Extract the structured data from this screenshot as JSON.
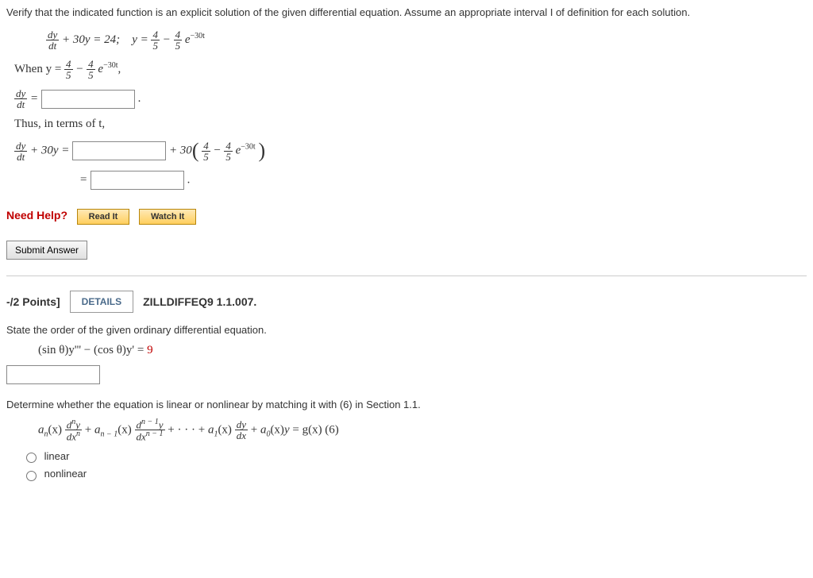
{
  "q1": {
    "instruction": "Verify that the indicated function is an explicit solution of the given differential equation. Assume an appropriate interval I of definition for each solution.",
    "eq_lhs_plus": " + 30y = 24;",
    "eq_y": "y = ",
    "dy": "dy",
    "dt": "dt",
    "four": "4",
    "five": "5",
    "minus": " − ",
    "exp": "e",
    "neg30t": "−30t",
    "when_y": "When y = ",
    "comma": ",",
    "equals": " = ",
    "period": ".",
    "thus": "Thus, in terms of t,",
    "plus30y": " + 30y = ",
    "plus30": " + 30",
    "need_help": "Need Help?",
    "read_it": "Read It",
    "watch_it": "Watch It",
    "submit": "Submit Answer"
  },
  "q2": {
    "points": "-/2 Points]",
    "details": "DETAILS",
    "source": "ZILLDIFFEQ9 1.1.007.",
    "instruction": "State the order of the given ordinary differential equation.",
    "ode": "(sin θ)y''' − (cos θ)y' = ",
    "rhs": "9",
    "determine": "Determine whether the equation is linear or nonlinear by matching it with (6) in Section 1.1.",
    "form_tail": " = g(x)    (6)",
    "linear": "linear",
    "nonlinear": "nonlinear",
    "an": "a",
    "n": "n",
    "nm1": "n − 1",
    "one": "1",
    "zero": "0",
    "x": "(x)",
    "d": "d",
    "y": "y",
    "dx": "dx",
    "plus": " + ",
    "dots": " + · · · + ",
    "dydx": "dy"
  }
}
